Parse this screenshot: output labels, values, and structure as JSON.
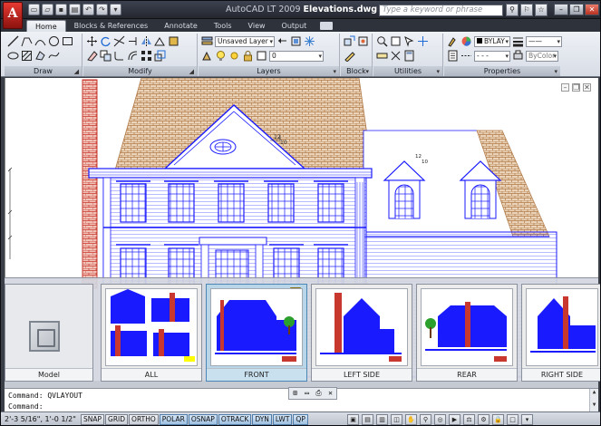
{
  "app": {
    "name": "AutoCAD LT 2009",
    "file": "Elevations.dwg",
    "logo_letter": "A"
  },
  "search": {
    "placeholder": "Type a keyword or phrase"
  },
  "ribbon": {
    "tabs": [
      "Home",
      "Blocks & References",
      "Annotate",
      "Tools",
      "View",
      "Output"
    ],
    "active_tab": "Home",
    "panels": {
      "draw": "Draw",
      "modify": "Modify",
      "layers": "Layers",
      "block": "Block",
      "utilities": "Utilities",
      "properties": "Properties"
    },
    "layer_dropdown": "Unsaved Layer",
    "layer_current": "0",
    "color_dropdown": "BYLAY",
    "bycolor_dropdown": "ByColor"
  },
  "drawing": {
    "pitch_label": "12",
    "pitch_run": "10"
  },
  "layouts": [
    {
      "label": "Model"
    },
    {
      "label": "ALL"
    },
    {
      "label": "FRONT"
    },
    {
      "label": "LEFT SIDE"
    },
    {
      "label": "REAR"
    },
    {
      "label": "RIGHT SIDE"
    }
  ],
  "command": {
    "history": "Command: QVLAYOUT",
    "prompt": "Command:"
  },
  "statusbar": {
    "coords": "2'-3 5/16\", 1'-0 1/2\"",
    "modes": [
      "SNAP",
      "GRID",
      "ORTHO",
      "POLAR",
      "OSNAP",
      "OTRACK",
      "DYN",
      "LWT",
      "QP"
    ],
    "modes_on": [
      "POLAR",
      "OSNAP",
      "OTRACK",
      "DYN",
      "LWT",
      "QP"
    ]
  },
  "colors": {
    "drawing_blue": "#1a1aff",
    "brick_red": "#c8382e",
    "roof_tan": "#c8a47a",
    "canvas": "#ffffff",
    "active_layout": "#b9d5e8"
  }
}
